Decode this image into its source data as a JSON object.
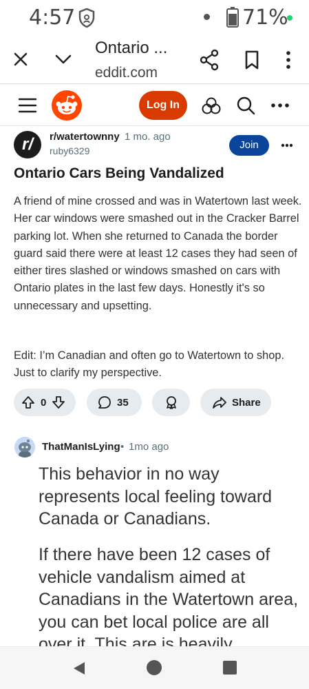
{
  "status_bar": {
    "time": "4:57",
    "battery": "71%"
  },
  "browser": {
    "title": "Ontario ...",
    "url": "eddit.com"
  },
  "header": {
    "login_label": "Log In"
  },
  "post": {
    "community_avatar_text": "r/",
    "community": "r/watertownny",
    "time": "1 mo. ago",
    "author": "ruby6329",
    "join_label": "Join",
    "title": "Ontario Cars Being Vandalized",
    "body": "A friend of mine crossed and was in Watertown last week. Her car windows were smashed out in the Cracker Barrel parking lot. When she returned to Canada the border guard said there were at least 12 cases they had seen of either tires slashed or windows smashed on cars with Ontario plates in the last few days. Honestly it's so unnecessary and upsetting.",
    "edit": "Edit: I’m Canadian and often go to Watertown to shop. Just to clarify my perspective.",
    "votes": "0",
    "comments": "35",
    "share_label": "Share"
  },
  "comment": {
    "author": "ThatManIsLying",
    "separator": "•",
    "time": "1mo ago",
    "paragraph1": "This behavior in no way represents local feeling toward Canada or Canadians.",
    "paragraph2": "If there have been 12 cases of vehicle vandalism aimed at Canadians in the Watertown area, you can bet local police are all over it. This are is heavily"
  },
  "colors": {
    "brand": "#ff4500",
    "login": "#d93a00",
    "join": "#0a449b",
    "pill": "#e5ebee",
    "status_dot": "#2ecc71"
  },
  "icons": [
    "shield-icon",
    "battery-icon",
    "close-icon",
    "chevron-down-icon",
    "share-icon",
    "bookmark-icon",
    "more-vert-icon",
    "menu-icon",
    "reddit-logo-icon",
    "popular-icon",
    "search-icon",
    "more-horiz-icon",
    "upvote-icon",
    "downvote-icon",
    "comment-icon",
    "award-icon",
    "share-arrow-icon",
    "back-icon",
    "home-icon",
    "recents-icon"
  ]
}
